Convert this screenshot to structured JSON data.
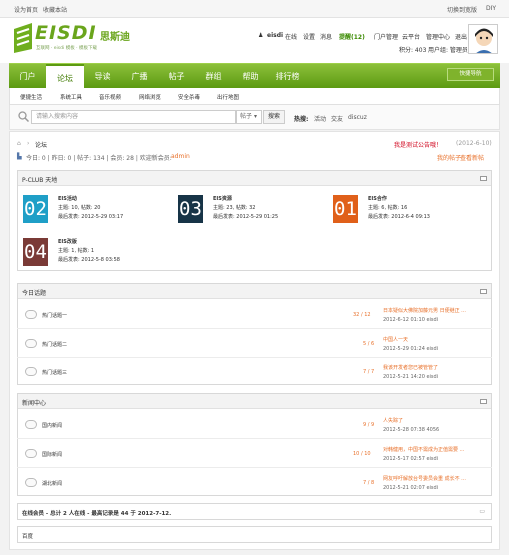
{
  "topbar": {
    "set_home": "设为首页",
    "bookmark": "收藏本站",
    "switch_style": "切换到宽版",
    "diy": "DIY"
  },
  "header": {
    "logo_text": "EISDI",
    "logo_cn": "思斯迪",
    "logo_sub": "互联网 · eisdi 模板 · 模板下载",
    "username": "eisdi",
    "online": "在线",
    "settings": "设置",
    "messages": "消息",
    "reminders": "提醒(12)",
    "portal_admin": "门户管理",
    "cloud_platform": "云平台",
    "admin_center": "管理中心",
    "logout": "退出",
    "points": "积分: 403",
    "user_group": "用户组: 管理员"
  },
  "nav": {
    "items": [
      "门户",
      "论坛",
      "导读",
      "广播",
      "帖子",
      "群组",
      "帮助",
      "排行榜"
    ],
    "quick": "快捷导航"
  },
  "subnav": {
    "items": [
      "便捷生活",
      "系统工具",
      "音乐视频",
      "网络浏览",
      "安全杀毒",
      "出行地图"
    ]
  },
  "search": {
    "placeholder": "请输入搜索内容",
    "type": "帖子",
    "button": "搜索",
    "hot_label": "热搜:",
    "hot": [
      "活动",
      "交友",
      "discuz"
    ]
  },
  "crumbs": {
    "forum": "论坛",
    "announce": "我是测试公告哦！",
    "announce_date": "(2012-6-10)",
    "stats": "今日: 0 | 昨日: 0 | 帖子: 134 | 会员: 28 | 欢迎新会员:",
    "new_member": "admin",
    "my_posts": "我的帖子",
    "latest": "查看新帖"
  },
  "pclub": {
    "title": "P-CLUB 天地",
    "forums": [
      {
        "num": "02",
        "name": "EIS活动",
        "stats": "主题: 10, 帖数: 20",
        "last": "最后发表: 2012-5-29 03:17",
        "color": "#1f9fc7"
      },
      {
        "num": "03",
        "name": "EIS资源",
        "stats": "主题: 23, 帖数: 32",
        "last": "最后发表: 2012-5-29 01:25",
        "color": "#173447"
      },
      {
        "num": "01",
        "name": "EIS合作",
        "stats": "主题: 6, 帖数: 16",
        "last": "最后发表: 2012-6-4 09:13",
        "color": "#e0601a"
      },
      {
        "num": "04",
        "name": "EIS改版",
        "stats": "主题: 1, 帖数: 1",
        "last": "最后发表: 2012-5-8 03:58",
        "color": "#7a3a36"
      }
    ]
  },
  "today": {
    "title": "今日话题",
    "rows": [
      {
        "name": "热门话题一",
        "count": "32 / 12",
        "last_title": "日本疑似大佛院加藤元男 日便继正 ...",
        "last_meta": "2012-6-12 01:10 eisdi"
      },
      {
        "name": "热门话题二",
        "count": "5 / 6",
        "last_title": "中国人一天",
        "last_meta": "2012-5-29 01:24 eisdi"
      },
      {
        "name": "热门话题三",
        "count": "7 / 7",
        "last_title": "我该开发者您已被管管了",
        "last_meta": "2012-5-21 14:20 eisdi"
      }
    ]
  },
  "news": {
    "title": "新闻中心",
    "rows": [
      {
        "name": "国内新闻",
        "count": "9 / 9",
        "last_title": "人失踪了",
        "last_meta": "2012-5-28 07:38 4056"
      },
      {
        "name": "国际新闻",
        "count": "10 / 10",
        "last_title": "对韩健用，中国不需成为正值需要 ...",
        "last_meta": "2012-5-17 02:57 eisdi"
      },
      {
        "name": "湖北新闻",
        "count": "7 / 8",
        "last_title": "网友呼吁解放台号委员会重 成长不 ...",
        "last_meta": "2012-5-21 02:07 eisdi"
      }
    ]
  },
  "online": {
    "text": "在线会员 - 总计 2 人在线 - 最高记录是 44 于 2012-7-12."
  },
  "footer_box": {
    "text": "百度"
  },
  "colors": {
    "green": "#5c9a12",
    "orange": "#e8702a"
  }
}
